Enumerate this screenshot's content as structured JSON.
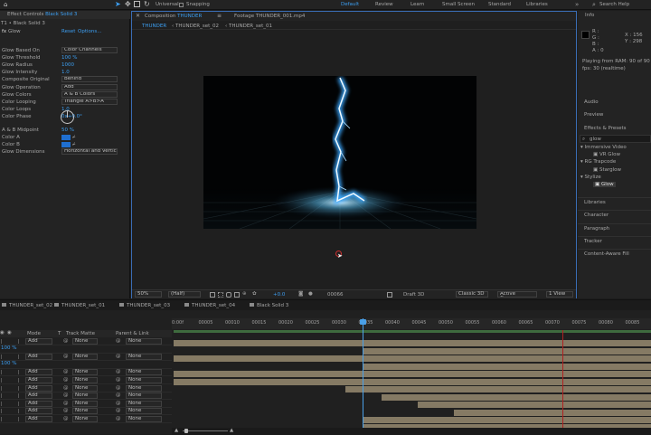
{
  "toolbar": {
    "universal": "Universal",
    "snapping": "Snapping",
    "workspaces": [
      "Default",
      "Review",
      "Learn",
      "Small Screen",
      "Standard",
      "Libraries"
    ],
    "active_workspace": "Default",
    "search_placeholder": "Search Help"
  },
  "effect_controls": {
    "tab": "Effect Controls",
    "layer": "Black Solid 3",
    "crumb": "T1 • Black Solid 3",
    "effect_name": "Glow",
    "reset": "Reset",
    "options": "Options...",
    "props": [
      {
        "label": "Glow Based On",
        "value": "Color Channels",
        "kind": "dd"
      },
      {
        "label": "Glow Threshold",
        "value": "100 %",
        "kind": "num"
      },
      {
        "label": "Glow Radius",
        "value": "1000",
        "kind": "num"
      },
      {
        "label": "Glow Intensity",
        "value": "1.0",
        "kind": "num"
      },
      {
        "label": "Composite Original",
        "value": "Behind",
        "kind": "dd"
      },
      {
        "label": "Glow Operation",
        "value": "Add",
        "kind": "dd"
      },
      {
        "label": "Glow Colors",
        "value": "A & B Colors",
        "kind": "dd"
      },
      {
        "label": "Color Looping",
        "value": "Triangle A>B>A",
        "kind": "dd"
      },
      {
        "label": "Color Loops",
        "value": "1.0",
        "kind": "num"
      },
      {
        "label": "Color Phase",
        "value": "0x+0.0°",
        "kind": "num"
      }
    ],
    "midpoint_label": "A & B Midpoint",
    "midpoint_value": "50 %",
    "color_a": "Color A",
    "color_b": "Color B",
    "dims_label": "Glow Dimensions",
    "dims_value": "Horizontal and Vertical",
    "color_hex": "#1f6fd0"
  },
  "viewer": {
    "comp_tab": "Composition",
    "comp_name": "THUNDER",
    "footage_tab": "Footage THUNDER_001.mp4",
    "crumbs": [
      "THUNDER",
      "THUNDER_set_02",
      "THUNDER_set_01"
    ],
    "zoom": "50%",
    "resolution": "(Half)",
    "plus_time": "+0.0",
    "frame": "00066",
    "renderer": "Draft 3D",
    "view3d": "Classic 3D",
    "camera": "Active Camera",
    "views": "1 View"
  },
  "info": {
    "title": "Info",
    "x": "X : 156",
    "y": "Y : 298",
    "rgb": [
      "R :",
      "G :",
      "B :",
      "A : 0"
    ],
    "status1": "Playing from RAM: 90 of 90",
    "status2": "fps: 30 (realtime)"
  },
  "panels": {
    "audio": "Audio",
    "preview": "Preview",
    "effects": "Effects & Presets",
    "search_value": "glow",
    "tree": [
      {
        "label": "Immersive Video",
        "indent": 0
      },
      {
        "label": "VR Glow",
        "indent": 2
      },
      {
        "label": "RG Trapcode",
        "indent": 0
      },
      {
        "label": "Starglow",
        "indent": 2
      },
      {
        "label": "Stylize",
        "indent": 0
      },
      {
        "label": "Glow",
        "indent": 2,
        "selected": true
      }
    ],
    "bottom": [
      "Libraries",
      "Character",
      "Paragraph",
      "Tracker",
      "Content-Aware Fill"
    ]
  },
  "timeline": {
    "tabs": [
      "THUNDER_set_02",
      "THUNDER_set_01",
      "THUNDER_set_03",
      "THUNDER_set_04",
      "Black Solid 3"
    ],
    "ruler": [
      "0:00f",
      "00005",
      "00010",
      "00015",
      "00020",
      "00025",
      "00030",
      "00035",
      "00040",
      "00045",
      "00050",
      "00055",
      "00060",
      "00065",
      "00070",
      "00075",
      "00080",
      "00085"
    ],
    "columns": {
      "mode": "Mode",
      "t": "T",
      "trkmat": "Track Matte",
      "parent": "Parent & Link"
    },
    "props": [
      {
        "label": "Opacity",
        "value": "100 %"
      },
      {
        "label": "",
        "value": "100 %"
      },
      {
        "label": "",
        "value": "100 %"
      }
    ],
    "mode_value": "Add",
    "matte_value": "None",
    "parent_value": "None"
  },
  "cursor_color": "#d03030"
}
